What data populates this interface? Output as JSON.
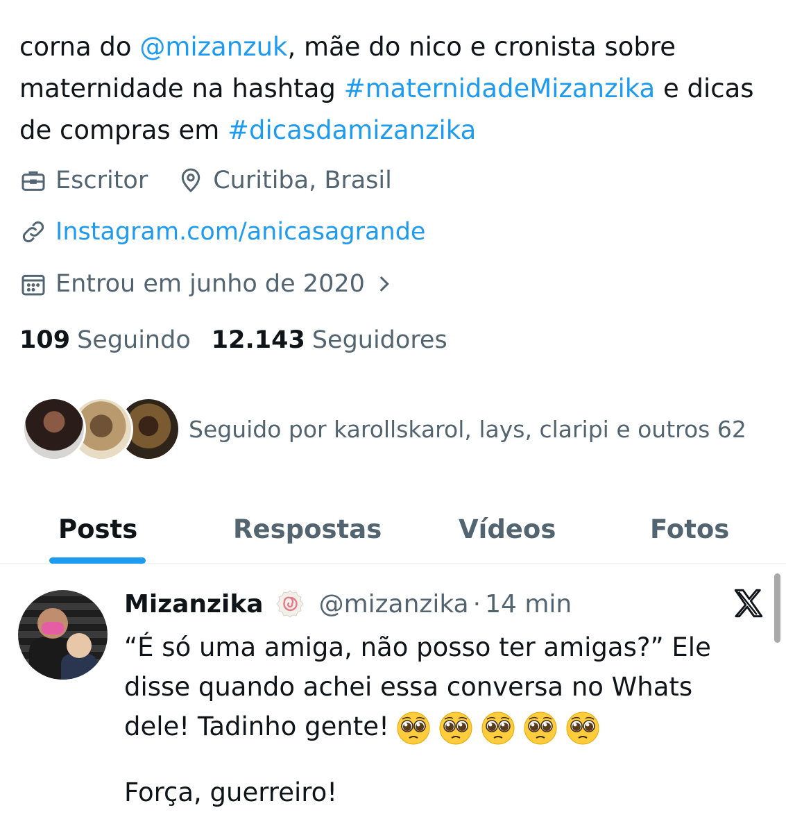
{
  "bio": {
    "part1": "corna do ",
    "mention": "@mizanzuk",
    "part2": ", mãe do nico e cronista sobre maternidade na hashtag ",
    "hashtag1": "#maternidadeMizanzika",
    "part3": " e dicas de compras em ",
    "hashtag2": "#dicasdamizanzika"
  },
  "meta": {
    "profession": "Escritor",
    "profession_icon": "briefcase-icon",
    "location": "Curitiba, Brasil",
    "location_icon": "location-pin-icon",
    "website": "Instagram.com/anicasagrande",
    "website_icon": "link-icon",
    "joined": "Entrou em junho de 2020",
    "joined_icon": "calendar-icon"
  },
  "stats": {
    "following_count": "109",
    "following_label": "Seguindo",
    "followers_count": "12.143",
    "followers_label": "Seguidores"
  },
  "followed_by": "Seguido por karollskarol, lays, claripi e outros 62",
  "tabs": [
    {
      "label": "Posts",
      "active": true
    },
    {
      "label": "Respostas",
      "active": false
    },
    {
      "label": "Vídeos",
      "active": false
    },
    {
      "label": "Fotos",
      "active": false
    }
  ],
  "post": {
    "name": "Mizanzika",
    "handle": "@mizanzika",
    "separator": "·",
    "time": "14 min",
    "text_line": "“É só uma amiga, não posso ter amigas?” Ele disse quando achei essa conversa no Whats dele! Tadinho gente!",
    "emoji_name": "pleading-face-icon",
    "emoji_count": 5,
    "text_line2": "Força, guerreiro!"
  },
  "colors": {
    "link": "#1d9bf0",
    "secondary_text": "#536471",
    "primary_text": "#0f1419"
  }
}
